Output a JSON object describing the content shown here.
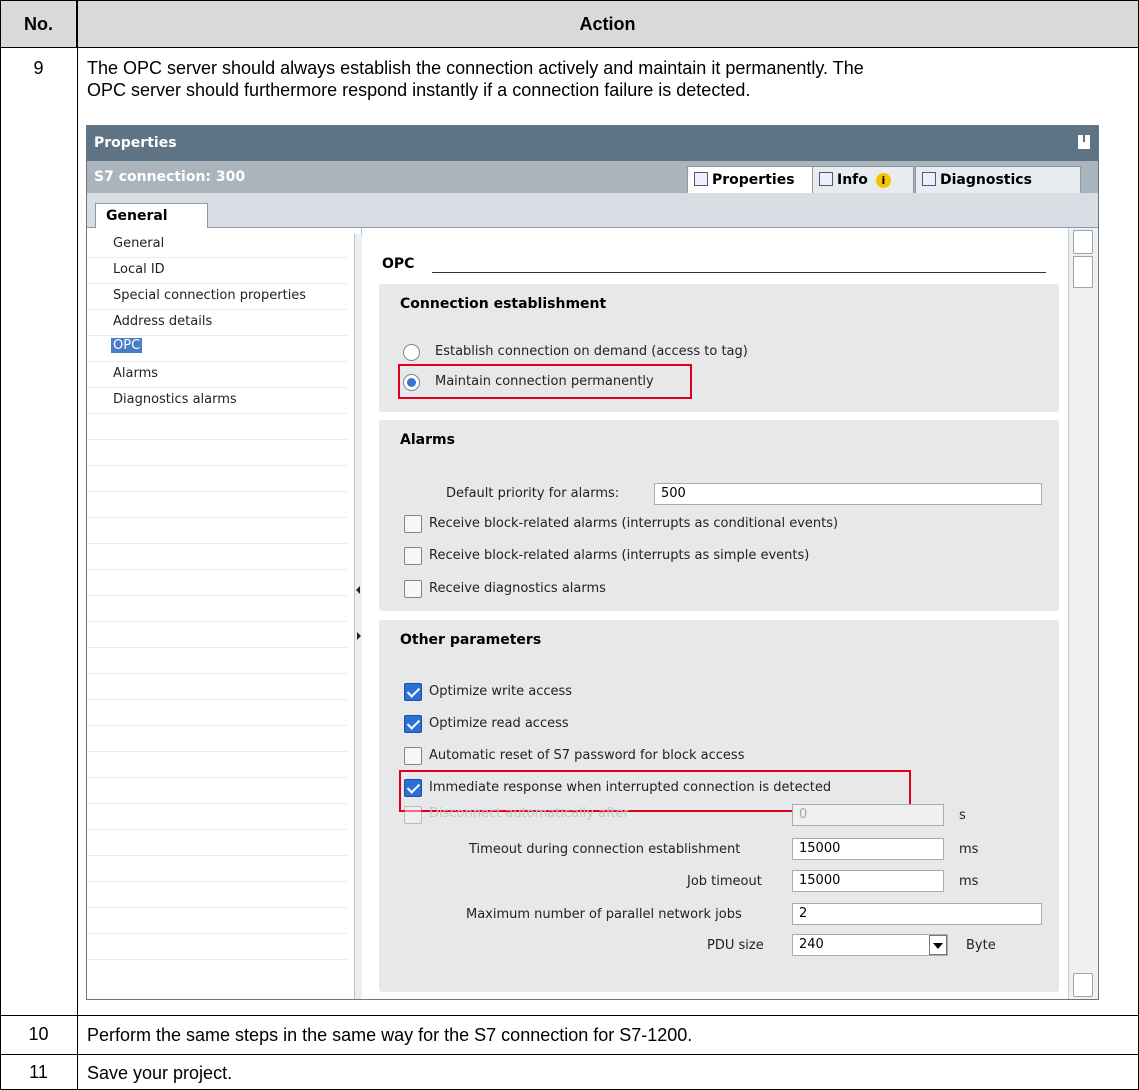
{
  "table": {
    "header_no": "No.",
    "header_action": "Action",
    "rows": [
      {
        "no": "9",
        "text_line1": "The OPC server should always establish the connection actively and maintain it permanently. The",
        "text_line2": "OPC server should furthermore respond instantly if a connection failure is detected."
      },
      {
        "no": "10",
        "text": "Perform the same steps in the same way for the S7 connection for S7-1200."
      },
      {
        "no": "11",
        "text": "Save your project."
      }
    ]
  },
  "window": {
    "title": "Properties",
    "connection": "S7 connection: 300",
    "tabs": {
      "properties": "Properties",
      "info": "Info",
      "info_badge": "i",
      "diagnostics": "Diagnostics"
    },
    "general_tab": "General"
  },
  "nav": {
    "items": [
      "General",
      "Local ID",
      "Special connection properties",
      "Address details",
      "OPC",
      "Alarms",
      "Diagnostics alarms"
    ],
    "selected": "OPC"
  },
  "opc": {
    "heading": "OPC",
    "connection_establishment": {
      "title": "Connection establishment",
      "option_on_demand": "Establish connection on demand (access to tag)",
      "option_permanent": "Maintain connection permanently",
      "selected": "permanent"
    },
    "alarms": {
      "title": "Alarms",
      "default_priority_label": "Default priority for alarms:",
      "default_priority_value": "500",
      "cb_conditional": "Receive block-related alarms (interrupts as conditional events)",
      "cb_simple": "Receive block-related alarms (interrupts as simple events)",
      "cb_diag": "Receive diagnostics alarms"
    },
    "other": {
      "title": "Other parameters",
      "cb_write": "Optimize write access",
      "cb_read": "Optimize read access",
      "cb_reset_pw": "Automatic reset of S7 password for block access",
      "cb_immediate": "Immediate response when interrupted connection is detected",
      "cb_disconnect": "Disconnect automatically after",
      "disconnect_value": "0",
      "disconnect_unit": "s",
      "timeout_label": "Timeout during connection establishment",
      "timeout_value": "15000",
      "timeout_unit": "ms",
      "job_timeout_label": "Job timeout",
      "job_timeout_value": "15000",
      "job_timeout_unit": "ms",
      "parallel_jobs_label": "Maximum number of parallel network jobs",
      "parallel_jobs_value": "2",
      "pdu_label": "PDU size",
      "pdu_value": "240",
      "pdu_unit": "Byte"
    }
  },
  "colors": {
    "highlight_box": "#e0001b",
    "title_bar": "#5e7383",
    "checkbox_checked": "#2c6fd6"
  }
}
